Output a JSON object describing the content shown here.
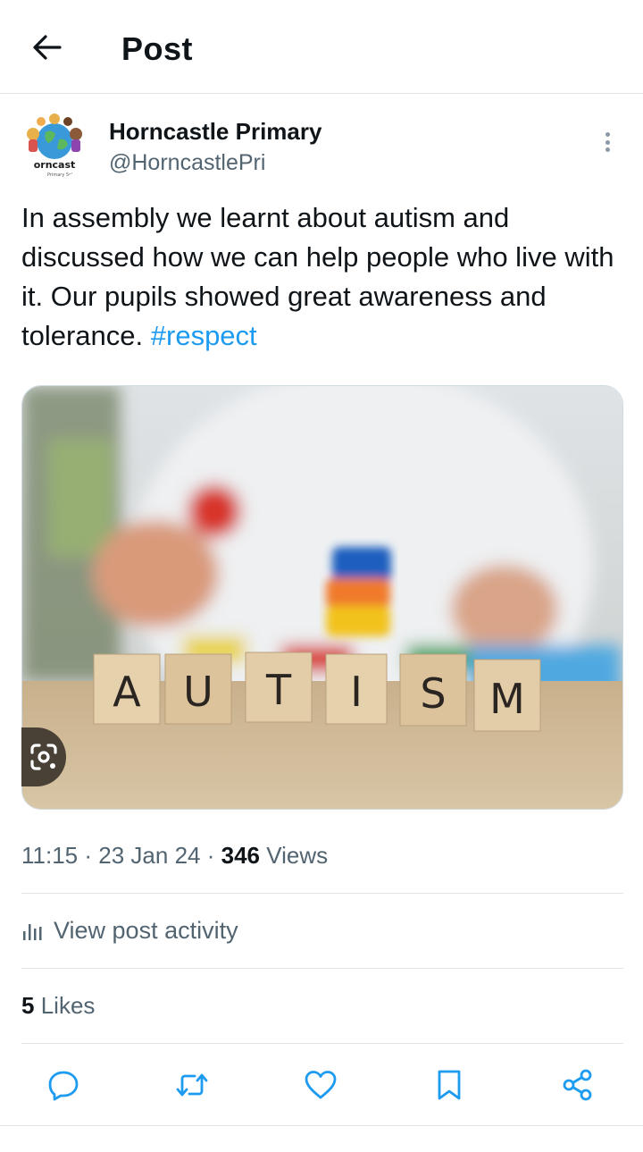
{
  "header": {
    "title": "Post",
    "back_icon": "arrow-left-icon"
  },
  "author": {
    "display_name": "Horncastle Primary",
    "handle": "@HorncastlePri",
    "avatar_logo_text": "Horncastle",
    "more_icon": "more-vertical-icon"
  },
  "post": {
    "text": "In assembly we learnt about autism and discussed how we can help people who live with it. Our pupils showed great awareness and tolerance.",
    "hashtag": "#respect",
    "image_letters": [
      "A",
      "U",
      "T",
      "I",
      "S",
      "M"
    ],
    "lens_icon": "google-lens-icon"
  },
  "meta": {
    "time": "11:15",
    "separator": "·",
    "date": "23 Jan 24",
    "views_count": "346",
    "views_label": "Views"
  },
  "activity": {
    "label": "View post activity",
    "icon": "bar-chart-icon"
  },
  "likes": {
    "count": "5",
    "label": "Likes"
  },
  "actions": {
    "reply_icon": "reply-icon",
    "repost_icon": "repost-icon",
    "like_icon": "heart-icon",
    "bookmark_icon": "bookmark-icon",
    "share_icon": "share-icon"
  },
  "colors": {
    "accent": "#1d9bf0",
    "text": "#0f1419",
    "secondary": "#536471",
    "border": "#e1e5e8"
  }
}
